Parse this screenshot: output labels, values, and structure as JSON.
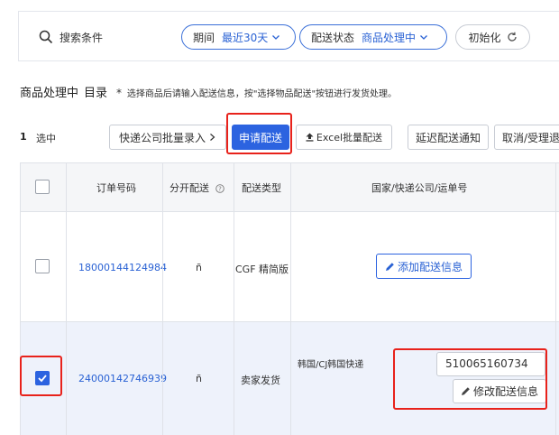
{
  "search": {
    "label": "搜索条件",
    "period_key": "期间",
    "period_value": "最近30天",
    "status_key": "配送状态",
    "status_value": "商品处理中",
    "reset_label": "初始化"
  },
  "list": {
    "title": "商品处理中",
    "catalog": "目录",
    "star": "*",
    "hint": "选择商品后请输入配送信息，按\"选择物品配送\"按钮进行发货处理。"
  },
  "toolbar": {
    "selected_count": "1",
    "selected_text": "选中",
    "batch_label": "快递公司批量录入",
    "apply_label": "申请配送",
    "excel_label": "Excel批量配送",
    "delay_label": "延迟配送通知",
    "cancel_label": "取消/受理退"
  },
  "table": {
    "headers": {
      "order_no": "订单号码",
      "split": "分开配送",
      "type": "配送类型",
      "info": "国家/快递公司/运单号"
    },
    "rows": [
      {
        "order_no": "18000144124984",
        "split": "ñ",
        "type": "CGF 精简版",
        "action_label": "添加配送信息",
        "checked": false
      },
      {
        "order_no": "24000142746939",
        "split": "ñ",
        "type": "卖家发货",
        "carrier": "韩国/CJ韩国快递",
        "tracking_no": "510065160734",
        "action_label": "修改配送信息",
        "checked": true
      }
    ]
  },
  "colors": {
    "accent": "#2c63e0",
    "link": "#2a62d4",
    "highlight": "#e8221b",
    "selected_row": "#eef2fb"
  },
  "icons": [
    "search-icon",
    "chevron-down-icon",
    "refresh-icon",
    "chevron-right-icon",
    "upload-icon",
    "help-icon",
    "pencil-icon",
    "check-icon"
  ]
}
